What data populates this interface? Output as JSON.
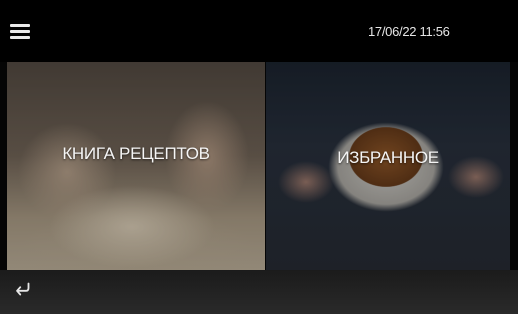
{
  "header": {
    "menu_icon": "hamburger-menu-icon",
    "datetime": "17/06/22 11:56"
  },
  "tiles": [
    {
      "label": "КНИГА  РЕЦЕПТОВ",
      "image": "kneading-dough-photo"
    },
    {
      "label": "ИЗБРАННОЕ",
      "image": "bread-loaf-photo"
    }
  ],
  "footer": {
    "back_icon": "return-arrow-icon"
  }
}
